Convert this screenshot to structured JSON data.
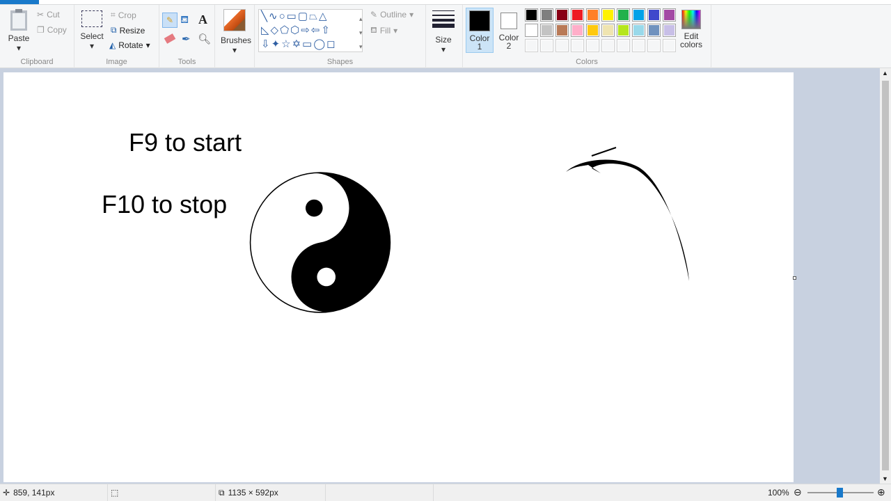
{
  "ribbon": {
    "clipboard": {
      "label": "Clipboard",
      "paste": "Paste",
      "cut": "Cut",
      "copy": "Copy"
    },
    "image": {
      "label": "Image",
      "select": "Select",
      "crop": "Crop",
      "resize": "Resize",
      "rotate": "Rotate"
    },
    "tools": {
      "label": "Tools"
    },
    "brushes": {
      "label": "Brushes"
    },
    "shapes": {
      "label": "Shapes",
      "outline": "Outline",
      "fill": "Fill"
    },
    "size": {
      "label": "Size"
    },
    "color1": {
      "label": "Color",
      "num": "1",
      "value": "#000000"
    },
    "color2": {
      "label": "Color",
      "num": "2",
      "value": "#ffffff"
    },
    "colors": {
      "label": "Colors",
      "row1": [
        "#000000",
        "#7f7f7f",
        "#880015",
        "#ed1c24",
        "#ff7f27",
        "#fff200",
        "#22b14c",
        "#00a2e8",
        "#3f48cc",
        "#a349a4"
      ],
      "row2": [
        "#ffffff",
        "#c3c3c3",
        "#b97a57",
        "#ffaec9",
        "#ffc90e",
        "#efe4b0",
        "#b5e61d",
        "#99d9ea",
        "#7092be",
        "#c8bfe7"
      ]
    },
    "edit_colors": {
      "line1": "Edit",
      "line2": "colors"
    }
  },
  "canvas": {
    "text1": "F9 to start",
    "text2": "F10 to stop"
  },
  "status": {
    "cursor": "859, 141px",
    "size": "1135 × 592px",
    "zoom": "100%",
    "zoom_level_percent": 100
  }
}
